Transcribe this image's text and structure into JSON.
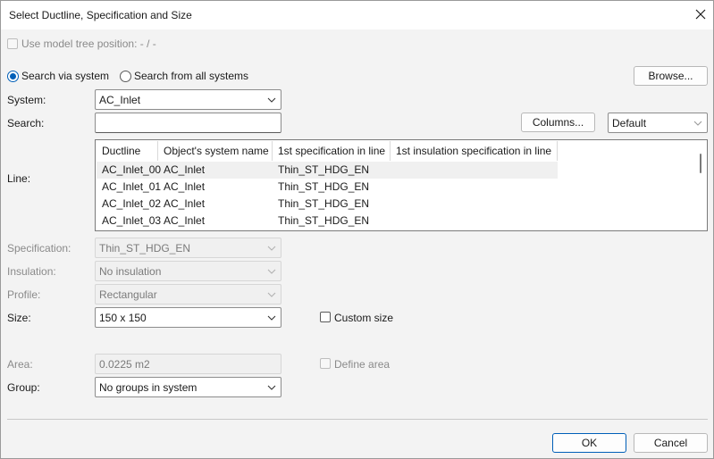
{
  "window": {
    "title": "Select Ductline, Specification and Size"
  },
  "model_tree": {
    "label": "Use model tree position: - / -",
    "checked": false
  },
  "search_mode": {
    "via_system": "Search via system",
    "all_systems": "Search from all systems",
    "selected": "via_system"
  },
  "buttons": {
    "browse": "Browse...",
    "columns": "Columns...",
    "ok": "OK",
    "cancel": "Cancel"
  },
  "system": {
    "label": "System:",
    "value": "AC_Inlet"
  },
  "search": {
    "label": "Search:",
    "value": "",
    "preset": "Default"
  },
  "line": {
    "label": "Line:",
    "columns": [
      "Ductline",
      "Object's system name",
      "1st specification in line",
      "1st insulation specification in line"
    ],
    "rows": [
      [
        "AC_Inlet_00",
        "AC_Inlet",
        "Thin_ST_HDG_EN",
        ""
      ],
      [
        "AC_Inlet_01",
        "AC_Inlet",
        "Thin_ST_HDG_EN",
        ""
      ],
      [
        "AC_Inlet_02",
        "AC_Inlet",
        "Thin_ST_HDG_EN",
        ""
      ],
      [
        "AC_Inlet_03",
        "AC_Inlet",
        "Thin_ST_HDG_EN",
        ""
      ]
    ]
  },
  "specification": {
    "label": "Specification:",
    "value": "Thin_ST_HDG_EN"
  },
  "insulation": {
    "label": "Insulation:",
    "value": "No insulation"
  },
  "profile": {
    "label": "Profile:",
    "value": "Rectangular"
  },
  "size": {
    "label": "Size:",
    "value": "150 x 150",
    "custom_label": "Custom size"
  },
  "area": {
    "label": "Area:",
    "value": "0.0225 m2",
    "define_label": "Define area"
  },
  "group": {
    "label": "Group:",
    "value": "No groups in system"
  },
  "icons": {
    "close": "close-icon",
    "dropdown": "chevron-down-icon"
  },
  "colors": {
    "accent": "#005fb8",
    "dialog_bg": "#f3f3f3"
  }
}
